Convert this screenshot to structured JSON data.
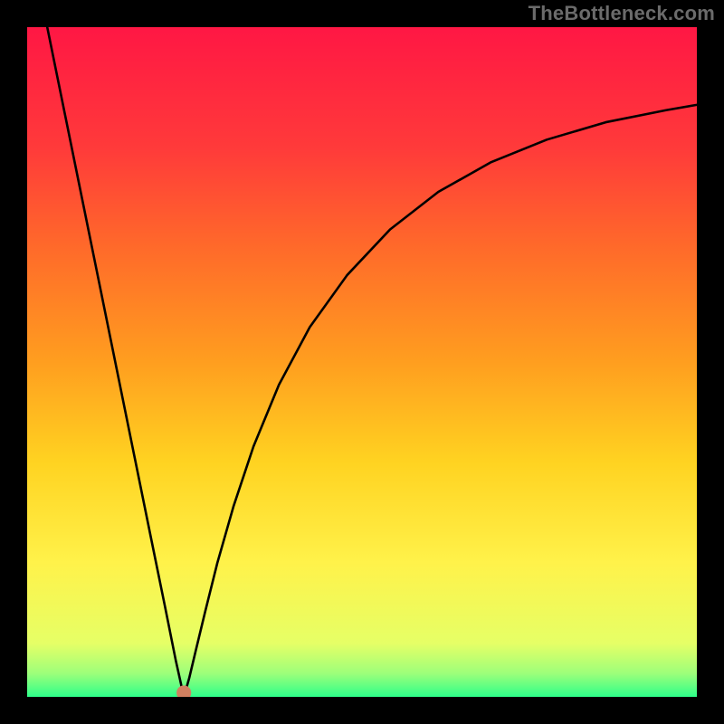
{
  "watermark": "TheBottleneck.com",
  "chart_data": {
    "type": "line",
    "title": "",
    "xlabel": "",
    "ylabel": "",
    "xlim": [
      0,
      100
    ],
    "ylim": [
      0,
      100
    ],
    "grid": false,
    "legend": false,
    "background_gradient": {
      "direction": "vertical",
      "stops": [
        {
          "pos": 0.0,
          "color": "#ff1744"
        },
        {
          "pos": 0.18,
          "color": "#ff3a3a"
        },
        {
          "pos": 0.33,
          "color": "#ff6a2a"
        },
        {
          "pos": 0.5,
          "color": "#ff9e1f"
        },
        {
          "pos": 0.65,
          "color": "#ffd321"
        },
        {
          "pos": 0.8,
          "color": "#fff24a"
        },
        {
          "pos": 0.92,
          "color": "#e6ff66"
        },
        {
          "pos": 0.965,
          "color": "#9dff7a"
        },
        {
          "pos": 1.0,
          "color": "#2eff8a"
        }
      ]
    },
    "series": [
      {
        "name": "curve",
        "color": "#000000",
        "points": [
          {
            "x": 3.0,
            "y": 100.0
          },
          {
            "x": 5.6,
            "y": 87.2
          },
          {
            "x": 8.2,
            "y": 74.4
          },
          {
            "x": 10.8,
            "y": 61.6
          },
          {
            "x": 13.4,
            "y": 48.8
          },
          {
            "x": 16.0,
            "y": 36.0
          },
          {
            "x": 18.6,
            "y": 23.2
          },
          {
            "x": 20.6,
            "y": 13.4
          },
          {
            "x": 22.2,
            "y": 5.4
          },
          {
            "x": 23.4,
            "y": 0.0
          },
          {
            "x": 24.2,
            "y": 2.8
          },
          {
            "x": 25.2,
            "y": 7.0
          },
          {
            "x": 26.6,
            "y": 12.8
          },
          {
            "x": 28.4,
            "y": 20.0
          },
          {
            "x": 30.8,
            "y": 28.4
          },
          {
            "x": 33.8,
            "y": 37.4
          },
          {
            "x": 37.6,
            "y": 46.6
          },
          {
            "x": 42.2,
            "y": 55.2
          },
          {
            "x": 47.8,
            "y": 63.0
          },
          {
            "x": 54.2,
            "y": 69.8
          },
          {
            "x": 61.4,
            "y": 75.4
          },
          {
            "x": 69.2,
            "y": 79.8
          },
          {
            "x": 77.6,
            "y": 83.2
          },
          {
            "x": 86.4,
            "y": 85.8
          },
          {
            "x": 95.4,
            "y": 87.6
          },
          {
            "x": 100.0,
            "y": 88.4
          }
        ]
      }
    ],
    "markers": [
      {
        "name": "min-dot",
        "x": 23.4,
        "y": 0.6,
        "color": "#d08060",
        "r": 1.1
      }
    ],
    "annotations": []
  }
}
